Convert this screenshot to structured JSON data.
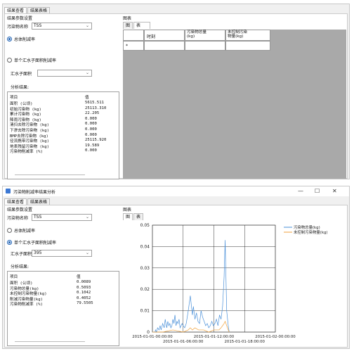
{
  "top": {
    "tabs": [
      "结果查看",
      "结果表格"
    ],
    "param_group": "结果参数设置",
    "pollutant_label": "污染物名称",
    "pollutant_value": "TSS",
    "radio_total": "总体削减率",
    "radio_single": "单个汇水子面积削减率",
    "catchment_label": "汇水子面积",
    "catchment_value": "",
    "analysis_label": "分析结果:",
    "col_item": "项目",
    "col_value": "值",
    "rows": [
      {
        "item": "面积 (公顷)",
        "value": "5615.511"
      },
      {
        "item": "初始污染物 (kg)",
        "value": "25113.310"
      },
      {
        "item": "累计污染物 (kg)",
        "value": "22.205"
      },
      {
        "item": "降雨污染物 (kg)",
        "value": "0.000"
      },
      {
        "item": "清扫去除污染物 (kg)",
        "value": "0.000"
      },
      {
        "item": "下渗去除污染物 (kg)",
        "value": "0.000"
      },
      {
        "item": "BMP去除污染物 (kg)",
        "value": "0.000"
      },
      {
        "item": "径流携带污染物 (kg)",
        "value": "25115.920"
      },
      {
        "item": "地表残留污染物 (kg)",
        "value": "19.589"
      },
      {
        "item": "污染物削减率 (%)",
        "value": "0.000"
      }
    ],
    "chart_group": "图表",
    "chart_tabs": [
      "图",
      "表"
    ],
    "grid_headers": [
      "时刻",
      "污染物总量\n(kg)",
      "未控制污染\n物量(kg)"
    ],
    "grid_new_row": "*"
  },
  "bottom": {
    "window_title": "污染物削减率结果分析",
    "tabs": [
      "结果查看",
      "结果表格"
    ],
    "param_group": "结果参数设置",
    "pollutant_label": "污染物名称",
    "pollutant_value": "TSS",
    "radio_total": "总体削减率",
    "radio_single": "单个汇水子面积削减率",
    "catchment_label": "汇水子面积",
    "catchment_value": "395",
    "analysis_label": "分析结果:",
    "col_item": "项目",
    "col_value": "值",
    "rows": [
      {
        "item": "面积 (公顷)",
        "value": "0.0089"
      },
      {
        "item": "污染物总量(kg)",
        "value": "0.5093"
      },
      {
        "item": "未控制污染物量(kg)",
        "value": "0.1042"
      },
      {
        "item": "削减污染物量(kg)",
        "value": "0.4052"
      },
      {
        "item": "污染物削减率 (%)",
        "value": "79.5505"
      }
    ],
    "chart_group": "图表",
    "chart_tabs": [
      "图",
      "表"
    ],
    "window_controls": [
      "—",
      "☐",
      "✕"
    ]
  },
  "chart_data": {
    "type": "line",
    "title": "",
    "xlabel": "",
    "ylabel": "",
    "ylim": [
      0,
      0.05
    ],
    "yticks": [
      "0",
      "0.01",
      "0.02",
      "0.03",
      "0.04",
      "0.05"
    ],
    "xticks": [
      "2015-01-01-00:00:00",
      "2015-01-01-06:00:00",
      "2015-01-01-12:00:00",
      "2015-01-01-18:00:00",
      "2015-01-02-00:00:00"
    ],
    "grid": true,
    "legend_position": "top-right",
    "series": [
      {
        "name": "污染物总量(kg)",
        "color": "#4a90d9",
        "x": [
          0,
          0.5,
          0.6,
          0.8,
          1,
          1.3,
          1.5,
          1.7,
          2,
          2.3,
          2.5,
          2.8,
          3,
          3.2,
          3.4,
          3.6,
          3.8,
          4,
          4.2,
          4.4,
          4.6,
          4.8,
          5,
          5.2,
          5.4,
          5.6,
          5.8,
          6,
          6.3,
          6.6,
          7,
          7.4,
          7.8,
          8,
          8.3,
          8.6,
          8.9,
          9.2,
          9.5,
          9.8,
          10.1,
          10.4,
          10.7,
          11,
          11.3,
          11.6,
          11.9,
          12.2,
          12.5,
          12.8,
          13.1,
          13.4,
          13.7,
          14,
          14.2,
          14.5,
          14.8,
          15
        ],
        "y": [
          0,
          0,
          0.001,
          0,
          0.002,
          0.001,
          0.003,
          0.001,
          0.004,
          0.002,
          0.006,
          0.002,
          0.005,
          0.003,
          0.004,
          0.002,
          0.003,
          0.006,
          0.004,
          0.008,
          0.003,
          0.005,
          0.004,
          0.006,
          0.002,
          0.003,
          0.004,
          0.003,
          0.002,
          0.004,
          0.01,
          0.017,
          0.008,
          0.012,
          0.006,
          0.009,
          0.005,
          0.004,
          0.01,
          0.007,
          0.005,
          0.003,
          0.004,
          0.002,
          0.003,
          0.005,
          0.003,
          0.004,
          0.006,
          0.003,
          0.008,
          0.006,
          0.012,
          0.026,
          0.043,
          0.01,
          0.003,
          0
        ]
      },
      {
        "name": "未控制污染物量(kg)",
        "color": "#f0a23c",
        "x": [
          0,
          2,
          4,
          6,
          7,
          7.4,
          7.8,
          8.3,
          9,
          10,
          11,
          12,
          13,
          13.4,
          13.7,
          14,
          14.2,
          14.5,
          14.8,
          15
        ],
        "y": [
          0,
          0,
          0.001,
          0,
          0.001,
          0.002,
          0.001,
          0.002,
          0.001,
          0.001,
          0,
          0.001,
          0.001,
          0.002,
          0.003,
          0.004,
          0.005,
          0.003,
          0.001,
          0
        ]
      }
    ],
    "x_range": [
      0,
      24
    ]
  }
}
